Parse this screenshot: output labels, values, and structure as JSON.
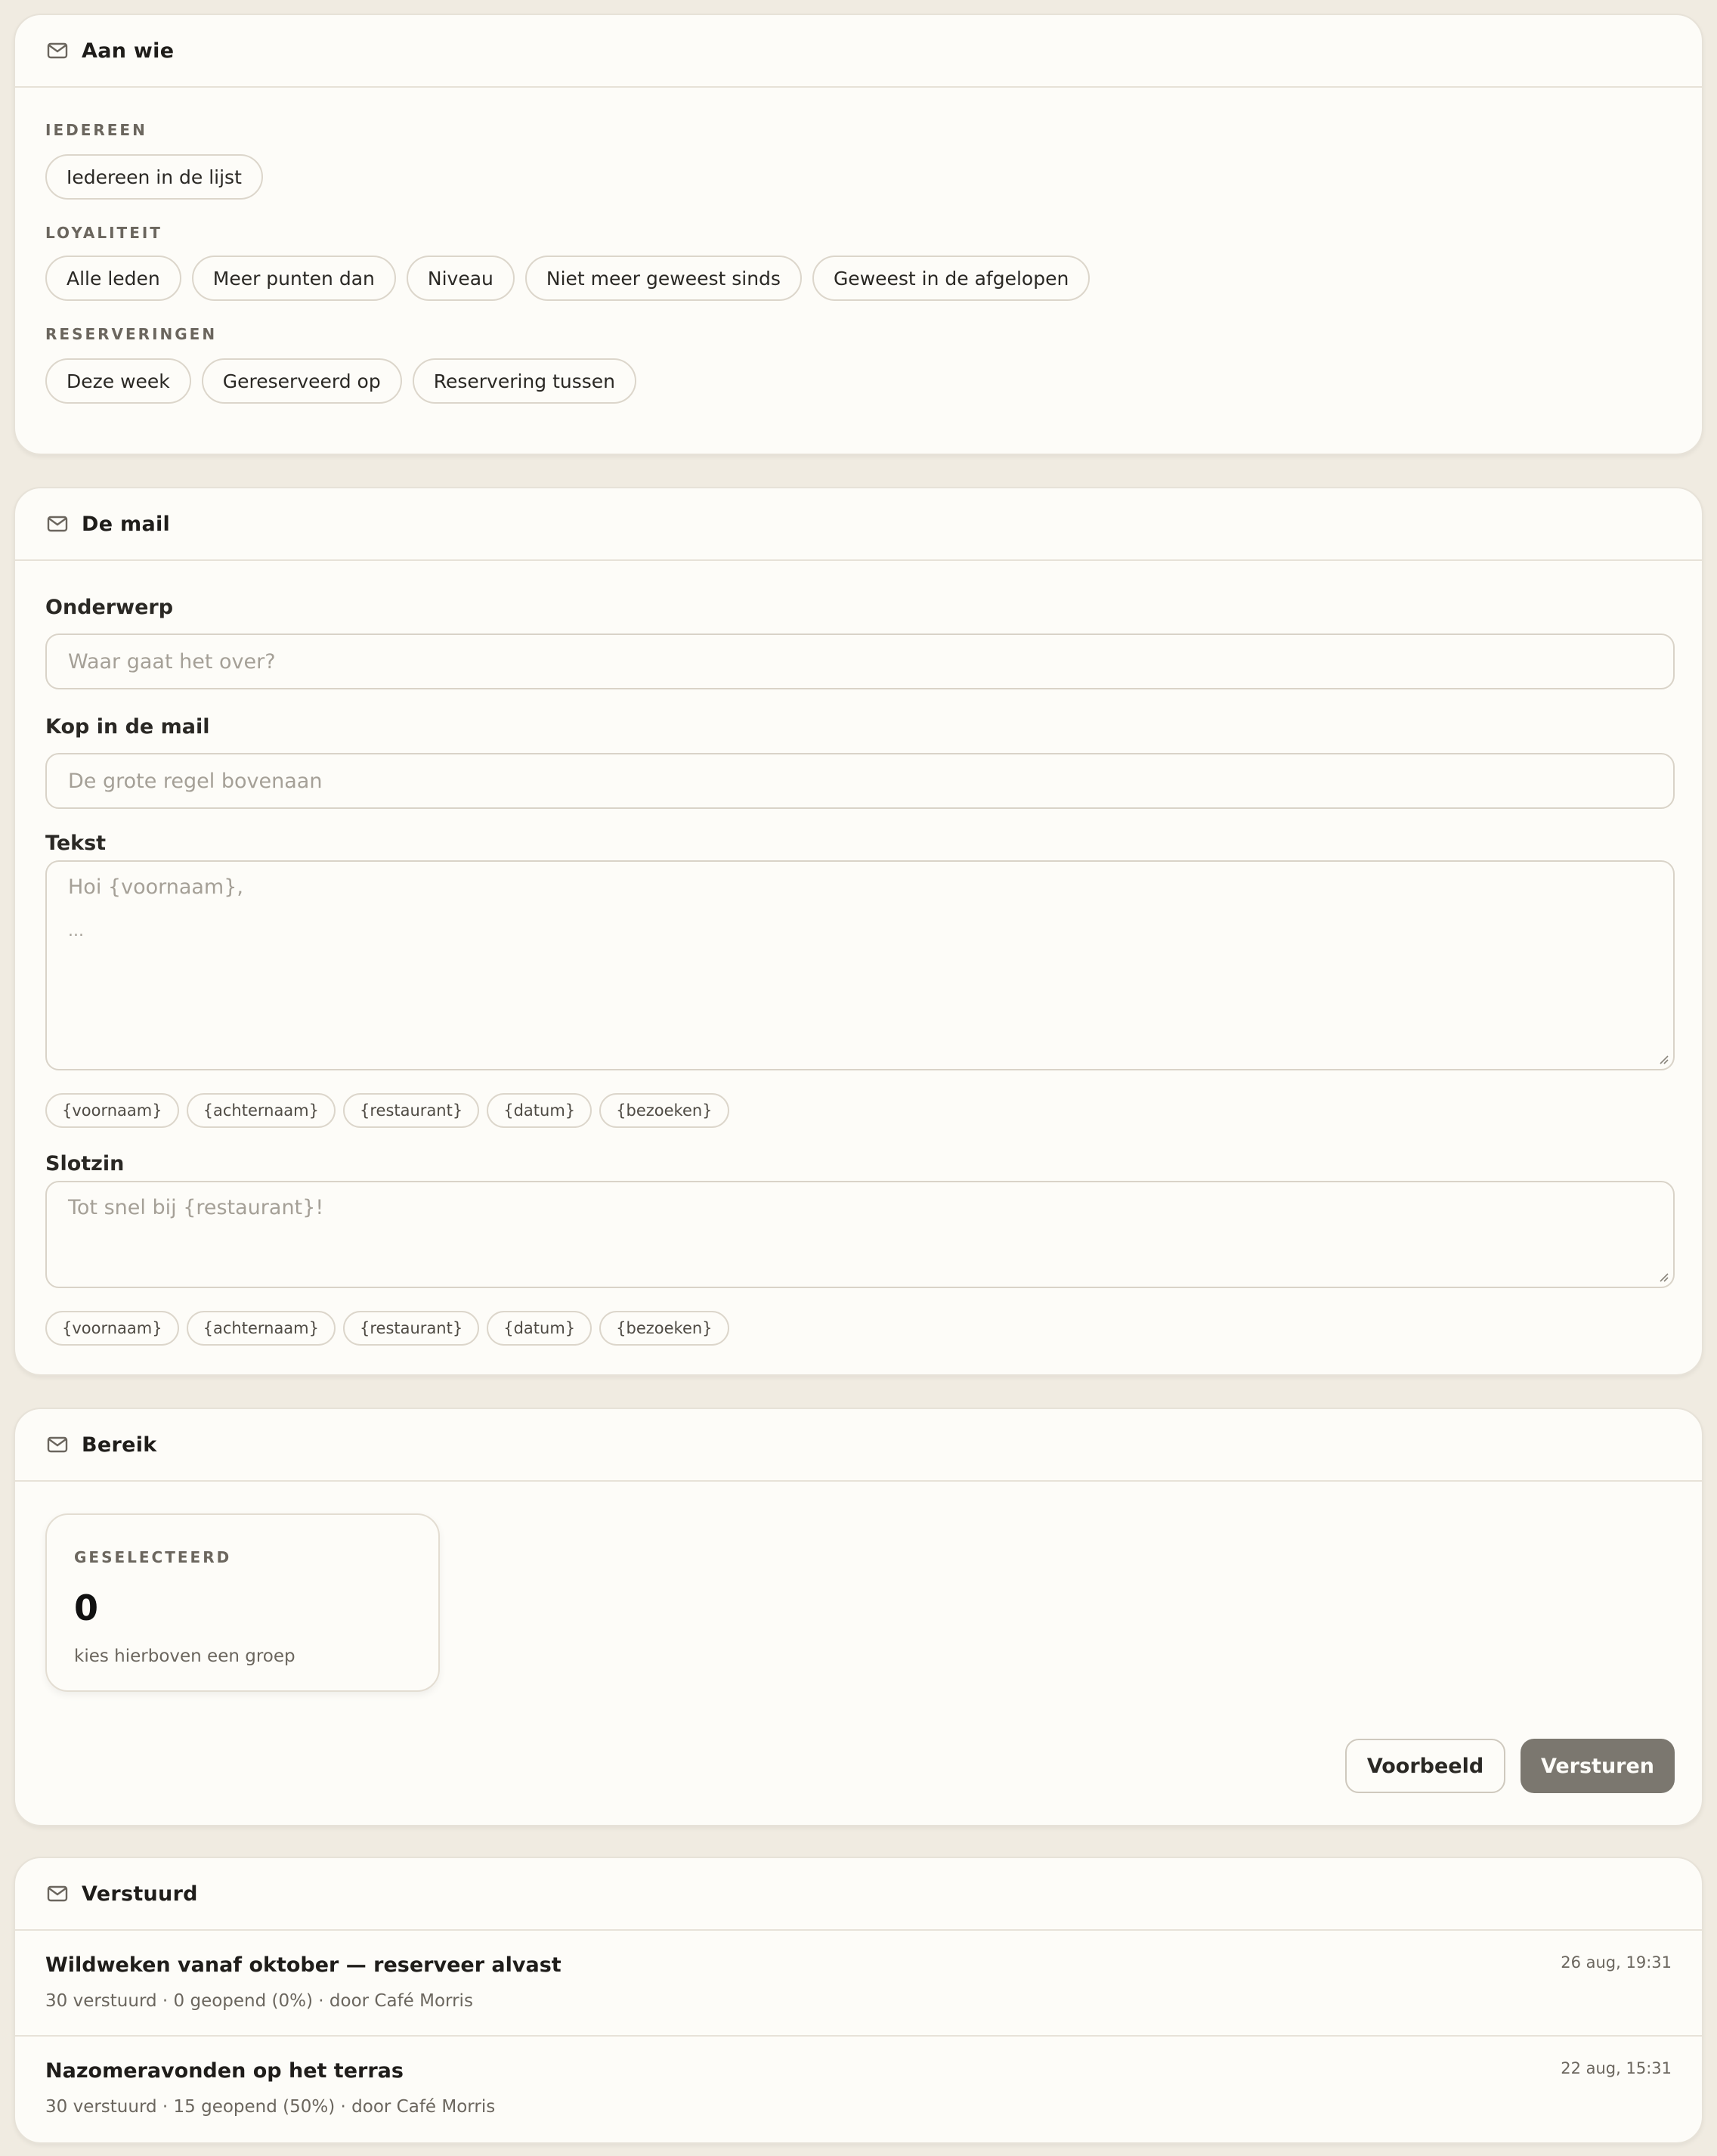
{
  "audience": {
    "title": "Aan wie",
    "icon": "mail-icon",
    "groups": [
      {
        "label": "IEDEREEN",
        "chips": [
          "Iedereen in de lijst"
        ]
      },
      {
        "label": "LOYALITEIT",
        "chips": [
          "Alle leden",
          "Meer punten dan",
          "Niveau",
          "Niet meer geweest sinds",
          "Geweest in de afgelopen"
        ]
      },
      {
        "label": "RESERVERINGEN",
        "chips": [
          "Deze week",
          "Gereserveerd op",
          "Reservering tussen"
        ]
      }
    ]
  },
  "mail": {
    "title": "De mail",
    "icon": "mail-icon",
    "subject": {
      "label": "Onderwerp",
      "placeholder": "Waar gaat het over?",
      "value": ""
    },
    "heading": {
      "label": "Kop in de mail",
      "placeholder": "De grote regel bovenaan",
      "value": ""
    },
    "body": {
      "label": "Tekst",
      "placeholder_line1": "Hoi {voornaam},",
      "placeholder_line2": "...",
      "value": ""
    },
    "closing": {
      "label": "Slotzin",
      "placeholder": "Tot snel bij {restaurant}!",
      "value": ""
    },
    "tokens": [
      "{voornaam}",
      "{achternaam}",
      "{restaurant}",
      "{datum}",
      "{bezoeken}"
    ]
  },
  "reach": {
    "title": "Bereik",
    "icon": "mail-icon",
    "stat_label": "GESELECTEERD",
    "stat_value": "0",
    "stat_hint": "kies hierboven een groep",
    "preview_label": "Voorbeeld",
    "send_label": "Versturen"
  },
  "sent": {
    "title": "Verstuurd",
    "icon": "mail-icon",
    "items": [
      {
        "title": "Wildweken vanaf oktober — reserveer alvast",
        "meta": "30 verstuurd · 0 geopend (0%) · door Café Morris",
        "date": "26 aug, 19:31"
      },
      {
        "title": "Nazomeravonden op het terras",
        "meta": "30 verstuurd · 15 geopend (50%) · door Café Morris",
        "date": "22 aug, 15:31"
      }
    ]
  },
  "colors": {
    "page_bg": "#f0ebe1",
    "card_bg": "#fdfcf8",
    "primary_button": "#7b776f",
    "border": "#e7e2d8"
  }
}
